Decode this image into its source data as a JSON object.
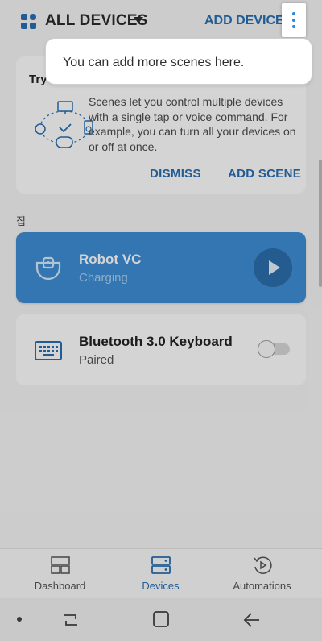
{
  "header": {
    "title": "ALL DEVICES",
    "add_device_label": "ADD DEVICE",
    "icons": {
      "menu": "grid-icon",
      "dropdown": "caret-down-icon",
      "more": "more-vert-icon"
    }
  },
  "tooltip": {
    "text": "You can add more scenes here."
  },
  "scene_card": {
    "title": "Try",
    "description": "Scenes let you control multiple devices with a single tap or voice command. For example, you can turn all your devices on or off at once.",
    "dismiss_label": "DISMISS",
    "add_scene_label": "ADD SCENE"
  },
  "room": {
    "label": "집"
  },
  "devices": [
    {
      "name": "Robot VC",
      "status": "Charging",
      "icon": "robot-vacuum-icon",
      "action": "play"
    },
    {
      "name": "Bluetooth 3.0 Keyboard",
      "status": "Paired",
      "icon": "keyboard-icon",
      "toggle_on": false
    }
  ],
  "bottom_nav": {
    "items": [
      {
        "label": "Dashboard",
        "icon": "dashboard-icon",
        "active": false
      },
      {
        "label": "Devices",
        "icon": "devices-icon",
        "active": true
      },
      {
        "label": "Automations",
        "icon": "automations-icon",
        "active": false
      }
    ]
  },
  "colors": {
    "accent": "#2a6fb3",
    "card_active": "#3f8fd6"
  }
}
